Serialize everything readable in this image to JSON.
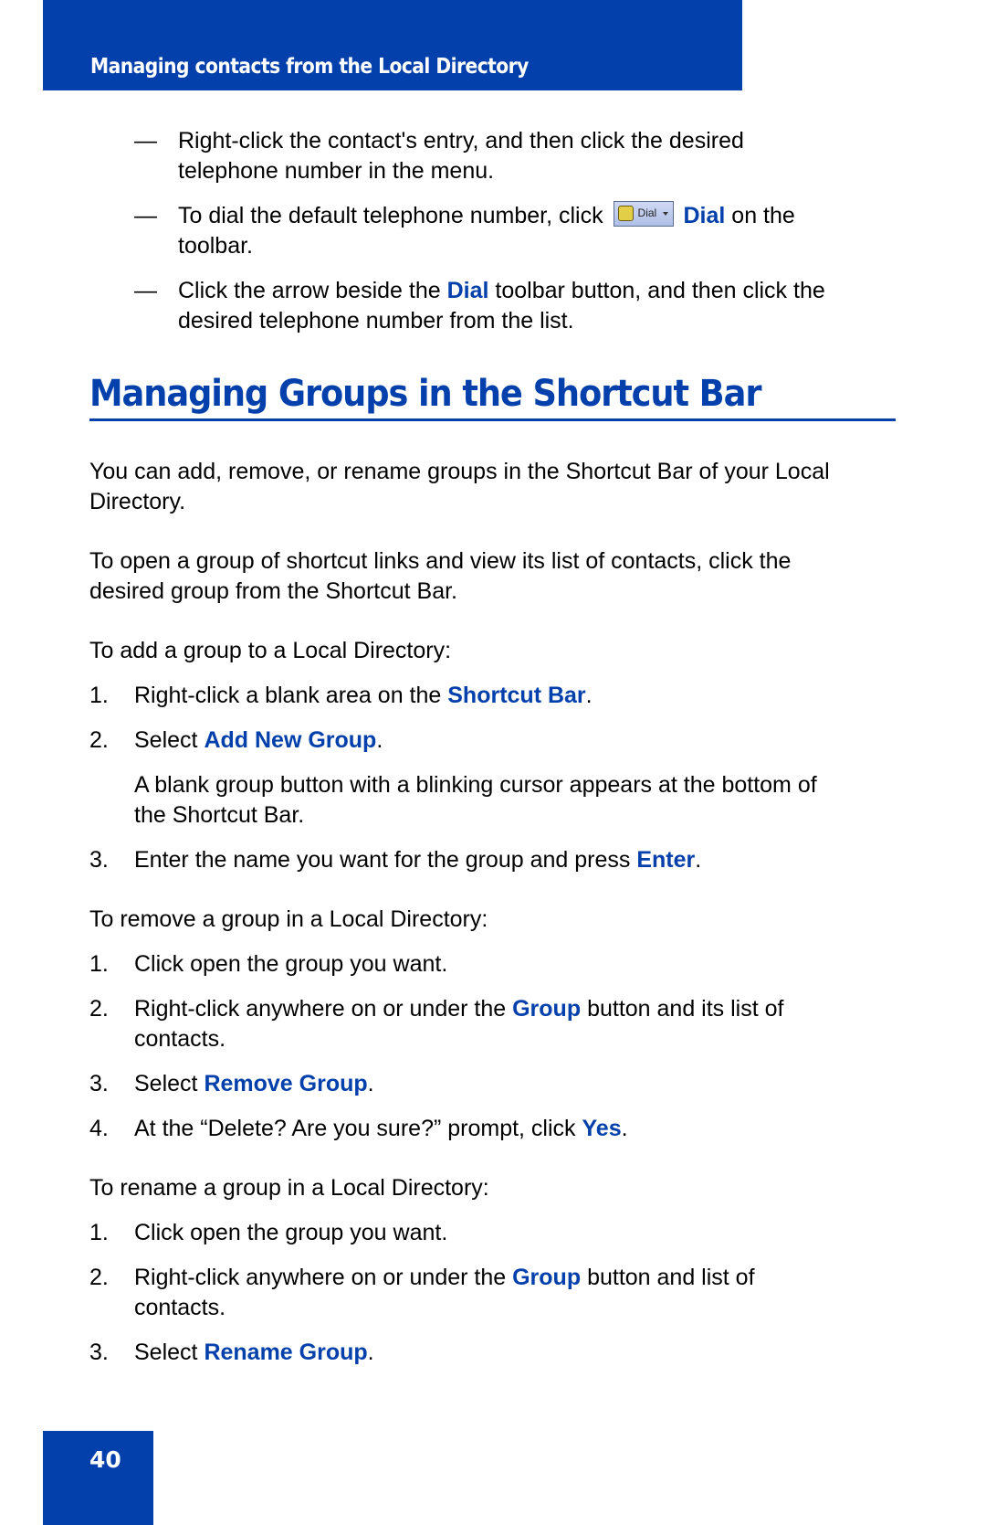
{
  "header": {
    "title": "Managing contacts from the Local Directory"
  },
  "intro_bullets": [
    {
      "marker": "—",
      "line1": "Right-click the contact's entry, and then click the desired",
      "line2": "telephone number in the menu."
    },
    {
      "marker": "—",
      "pre": "To dial the default telephone number, click",
      "button_label": "Dial",
      "hl": "Dial",
      "post": "on the",
      "line2": "toolbar."
    },
    {
      "marker": "—",
      "pre": "Click the arrow beside the",
      "hl": "Dial",
      "post": "toolbar button, and then click the",
      "line2": "desired telephone number from the list."
    }
  ],
  "section": {
    "title": "Managing Groups in the Shortcut Bar",
    "para1_line1": "You can add, remove, or rename groups in the Shortcut Bar of your Local",
    "para1_line2": "Directory.",
    "para2_line1": "To open a group of shortcut links and view its list of contacts, click the",
    "para2_line2": "desired group from the Shortcut Bar."
  },
  "add_group": {
    "intro": "To add a group to a Local Directory:",
    "steps": [
      {
        "num": "1.",
        "pre": "Right-click a blank area on the",
        "hl": "Shortcut Bar",
        "post": "."
      },
      {
        "num": "2.",
        "pre": "Select",
        "hl": "Add New Group",
        "post": "."
      },
      {
        "num": "3.",
        "pre": "Enter the name you want for the group and press",
        "hl": "Enter",
        "post": "."
      }
    ],
    "note_line1": "A blank group button with a blinking cursor appears at the bottom of",
    "note_line2": "the Shortcut Bar."
  },
  "remove_group": {
    "intro": "To remove a group in a Local Directory:",
    "steps": [
      {
        "num": "1.",
        "text": "Click open the group you want."
      },
      {
        "num": "2.",
        "pre": "Right-click anywhere on or under the",
        "hl": "Group",
        "post": "button and its list of",
        "line2": "contacts."
      },
      {
        "num": "3.",
        "pre": "Select",
        "hl": "Remove Group",
        "post": "."
      },
      {
        "num": "4.",
        "pre": "At the “Delete? Are you sure?” prompt, click",
        "hl": "Yes",
        "post": "."
      }
    ]
  },
  "rename_group": {
    "intro": "To rename a group in a Local Directory:",
    "steps": [
      {
        "num": "1.",
        "text": "Click open the group you want."
      },
      {
        "num": "2.",
        "pre": "Right-click anywhere on or under the",
        "hl": "Group",
        "post": "button and list of",
        "line2": "contacts."
      },
      {
        "num": "3.",
        "pre": "Select",
        "hl": "Rename Group",
        "post": "."
      }
    ]
  },
  "footer": {
    "page_number": "40"
  }
}
